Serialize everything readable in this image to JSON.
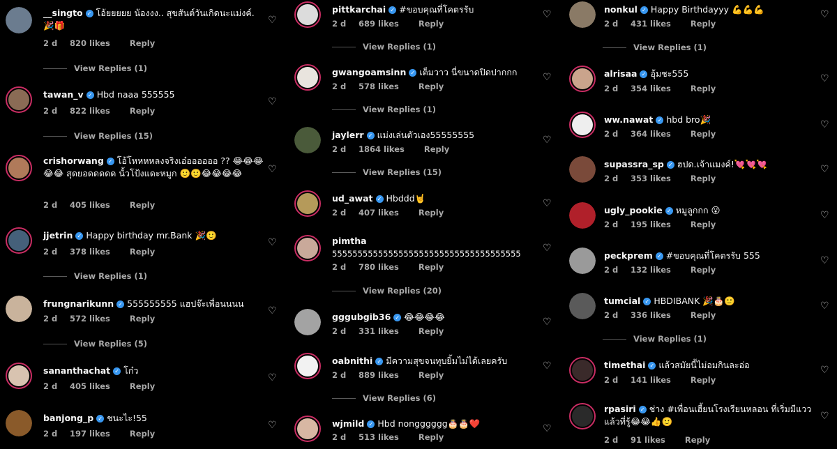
{
  "labels": {
    "reply": "Reply"
  },
  "columns": [
    {
      "comments": [
        {
          "user": "__singto",
          "verified": true,
          "text": "โอ้ยยยยย น้องงง.. สุขสันต์วันเกิดนะแม่งค์.🎉🎁",
          "time": "2 d",
          "likes": "820 likes",
          "replies": "View Replies (1)",
          "color": "#6b7c8f"
        },
        {
          "user": "tawan_v",
          "verified": true,
          "text": "Hbd naaa 555555",
          "time": "2 d",
          "likes": "822 likes",
          "replies": "View Replies (15)",
          "color": "#8a6b55"
        },
        {
          "user": "crishorwang",
          "verified": true,
          "text": "โอ้โหหหหลงจริงเอ๋ออออออ ?? 😂😂😂😂😂 สุดยอดดดดด นั้วโป้งแดะหมูก 🙂🙂😂😂😂😂",
          "time": "2 d",
          "likes": "405 likes",
          "replies": null,
          "color": "#b07a5a"
        },
        {
          "user": "jjetrin",
          "verified": true,
          "text": "Happy birthday mr.Bank 🎉🙂",
          "time": "2 d",
          "likes": "378 likes",
          "replies": "View Replies (1)",
          "color": "#45607a"
        },
        {
          "user": "frungnarikunn",
          "verified": true,
          "text": "555555555 แฮปจ๊ะเพื่อนนนน",
          "time": "2 d",
          "likes": "572 likes",
          "replies": "View Replies (5)",
          "color": "#c9b39c"
        },
        {
          "user": "sananthachat",
          "verified": true,
          "text": "โก๋ว",
          "time": "2 d",
          "likes": "405 likes",
          "replies": null,
          "color": "#d8c3b0"
        },
        {
          "user": "banjong_p",
          "verified": true,
          "text": "ชนะไะ!55",
          "time": "2 d",
          "likes": "197 likes",
          "replies": null,
          "color": "#8a5a2a"
        }
      ]
    },
    {
      "comments": [
        {
          "user": "pittkarchai",
          "verified": true,
          "text": "#ขอบคุณที่โคตรรับ",
          "time": "2 d",
          "likes": "689 likes",
          "replies": "View Replies (1)",
          "color": "#dcdcdc"
        },
        {
          "user": "gwangoamsinn",
          "verified": true,
          "text": "เต็มวาว นี่ขนาดปิดปากกก",
          "time": "2 d",
          "likes": "578 likes",
          "replies": "View Replies (1)",
          "color": "#e9e4de"
        },
        {
          "user": "jaylerr",
          "verified": true,
          "text": "แม่งเล่นตัวเอง55555555",
          "time": "2 d",
          "likes": "1864 likes",
          "replies": "View Replies (15)",
          "color": "#4a5a3a"
        },
        {
          "user": "ud_awat",
          "verified": true,
          "text": "Hbddd🤘",
          "time": "2 d",
          "likes": "407 likes",
          "replies": null,
          "color": "#b59a5a"
        },
        {
          "user": "pimtha",
          "verified": false,
          "text": "5555555555555555555555555555555555555",
          "time": "2 d",
          "likes": "780 likes",
          "replies": "View Replies (20)",
          "color": "#c9a99a"
        },
        {
          "user": "gggubgib36",
          "verified": true,
          "text": "😂😂😂😂",
          "time": "2 d",
          "likes": "331 likes",
          "replies": null,
          "color": "#a3a3a3"
        },
        {
          "user": "oabnithi",
          "verified": true,
          "text": "มีความสุขจนทุบยิ้มไม่ได้เลยครับ",
          "time": "2 d",
          "likes": "889 likes",
          "replies": "View Replies (6)",
          "color": "#f2f2f2"
        },
        {
          "user": "wjmild",
          "verified": true,
          "text": "Hbd nongggggg🎂🎂❤️",
          "time": "2 d",
          "likes": "513 likes",
          "replies": null,
          "color": "#d8b7a3"
        }
      ]
    },
    {
      "comments": [
        {
          "user": "nonkul",
          "verified": true,
          "text": "Happy Birthdayyy 💪💪💪",
          "time": "2 d",
          "likes": "431 likes",
          "replies": "View Replies (1)",
          "color": "#8a7a66"
        },
        {
          "user": "alrisaa",
          "verified": true,
          "text": "อุ้มชะ555",
          "time": "2 d",
          "likes": "354 likes",
          "replies": null,
          "color": "#caa48c"
        },
        {
          "user": "ww.nawat",
          "verified": true,
          "text": "hbd bro🎉",
          "time": "2 d",
          "likes": "364 likes",
          "replies": null,
          "color": "#eeeeee"
        },
        {
          "user": "supassra_sp",
          "verified": true,
          "text": "ฮปด.เจ้าแมงค์!💘💘💘",
          "time": "2 d",
          "likes": "353 likes",
          "replies": null,
          "color": "#7a4a3a"
        },
        {
          "user": "ugly_pookie",
          "verified": true,
          "text": "หมูลูกกก 😮",
          "time": "2 d",
          "likes": "195 likes",
          "replies": null,
          "color": "#b0202a"
        },
        {
          "user": "peckprem",
          "verified": true,
          "text": "#ขอบคุณที่โคตรรับ 555",
          "time": "2 d",
          "likes": "132 likes",
          "replies": null,
          "color": "#9a9a9a"
        },
        {
          "user": "tumcial",
          "verified": true,
          "text": "HBDIBANK 🎉🎂🙂",
          "time": "2 d",
          "likes": "336 likes",
          "replies": "View Replies (1)",
          "color": "#5a5a5a"
        },
        {
          "user": "timethai",
          "verified": true,
          "text": "แล้วสมัยนี้ไม่อมกินละอ่อ",
          "time": "2 d",
          "likes": "141 likes",
          "replies": null,
          "color": "#3a2a2a"
        },
        {
          "user": "rpasiri",
          "verified": true,
          "text": "ช่าง #เพื่อนเฮี้ยนโรงเรียนหลอน ที่เริ่มมีแววแล้วที่รู้😂😂👍🙂",
          "time": "2 d",
          "likes": "91 likes",
          "replies": null,
          "color": "#2a2a2a"
        }
      ]
    }
  ]
}
